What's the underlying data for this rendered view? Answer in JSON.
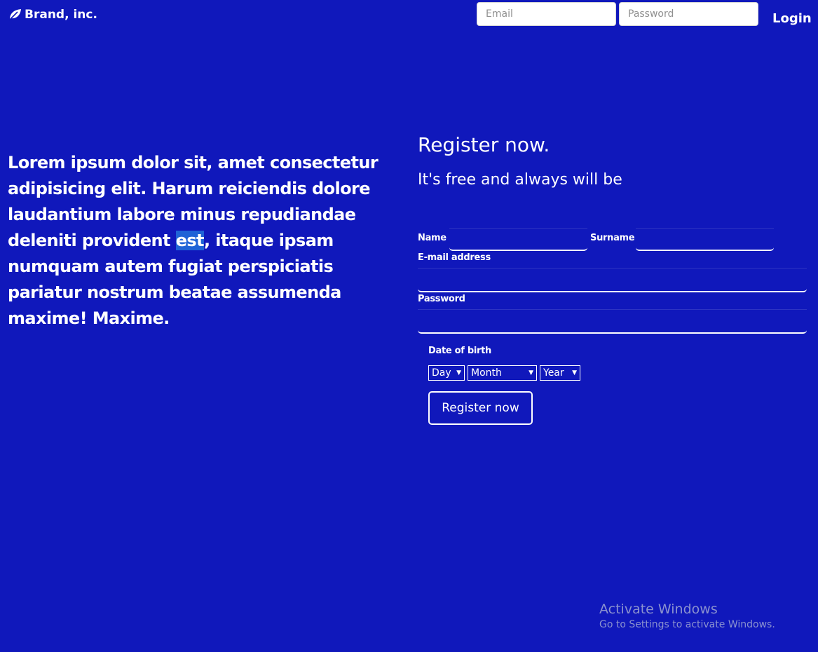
{
  "brand": {
    "name": "Brand, inc.",
    "icon": "leaf-icon"
  },
  "login": {
    "email_placeholder": "Email",
    "email_value": "",
    "password_placeholder": "Password",
    "password_value": "",
    "button_label": "Login"
  },
  "intro": {
    "text_before": "Lorem ipsum dolor sit, amet consectetur adipisicing elit. Harum reiciendis dolore laudantium labore minus repudiandae deleniti provident ",
    "highlighted": "est",
    "text_after": ", itaque ipsam numquam autem fugiat perspiciatis pariatur nostrum beatae assumenda maxime! Maxime."
  },
  "register": {
    "title": "Register now.",
    "subtitle": "It's free and always will be",
    "name_label": "Name",
    "surname_label": "Surname",
    "email_label": "E-mail address",
    "password_label": "Password",
    "dob_label": "Date of birth",
    "day_selected": "Day",
    "month_selected": "Month",
    "year_selected": "Year",
    "submit_label": "Register now"
  },
  "watermark": {
    "title": "Activate Windows",
    "subtitle": "Go to Settings to activate Windows."
  },
  "colors": {
    "background": "#1018bb",
    "text": "#ffffff",
    "selection": "#1f63d6",
    "watermark": "#8b92cf"
  }
}
